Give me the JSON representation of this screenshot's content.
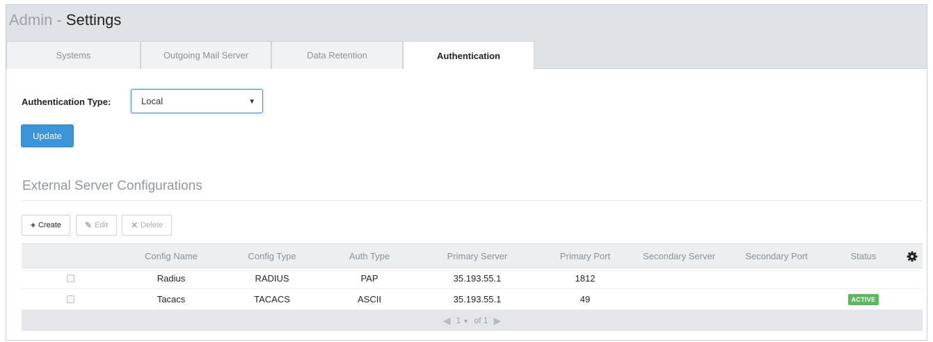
{
  "header": {
    "title_prefix": "Admin - ",
    "title_main": "Settings"
  },
  "tabs": [
    {
      "label": "Systems"
    },
    {
      "label": "Outgoing Mail Server"
    },
    {
      "label": "Data Retention"
    },
    {
      "label": "Authentication",
      "active": true
    }
  ],
  "auth": {
    "label": "Authentication Type:",
    "selected": "Local",
    "update_label": "Update"
  },
  "external": {
    "title": "External Server Configurations",
    "toolbar": {
      "create": "Create",
      "edit": "Edit",
      "delete": "Delete"
    },
    "columns": [
      "",
      "Config Name",
      "Config Type",
      "Auth Type",
      "Primary Server",
      "Primary Port",
      "Secondary Server",
      "Secondary Port",
      "Status"
    ],
    "rows": [
      {
        "name": "Radius",
        "type": "RADIUS",
        "auth_type": "PAP",
        "primary_server": "35.193.55.1",
        "primary_port": "1812",
        "secondary_server": "",
        "secondary_port": "",
        "status": ""
      },
      {
        "name": "Tacacs",
        "type": "TACACS",
        "auth_type": "ASCII",
        "primary_server": "35.193.55.1",
        "primary_port": "49",
        "secondary_server": "",
        "secondary_port": "",
        "status": "ACTIVE"
      }
    ],
    "pager": {
      "page": "1",
      "of": "of 1"
    }
  },
  "colors": {
    "accent": "#3b95d9",
    "active_badge": "#5cb85c",
    "header_bg": "#dfe3e8"
  },
  "icons": {
    "create": "plus-icon",
    "edit": "pencil-icon",
    "delete": "x-icon",
    "settings": "gear-icon",
    "prev": "prev-page-icon",
    "next": "next-page-icon",
    "dropdown": "caret-down-icon"
  }
}
